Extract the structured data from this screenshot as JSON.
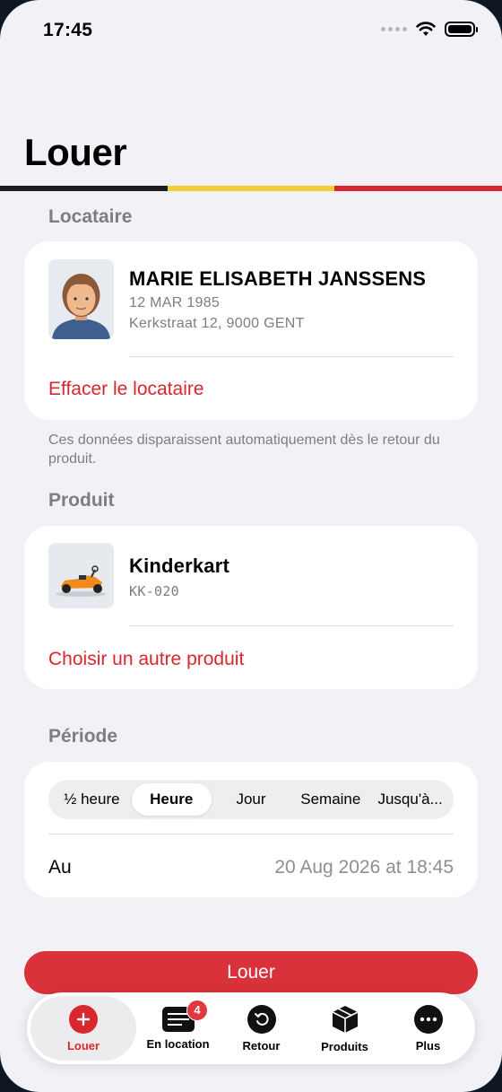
{
  "status_bar": {
    "time": "17:45"
  },
  "page": {
    "title": "Louer"
  },
  "colors": {
    "flag_black": "#1d1d1f",
    "flag_yellow": "#f0d034",
    "flag_red": "#d9272e",
    "accent": "#d9272e"
  },
  "renter": {
    "section_label": "Locataire",
    "name": "MARIE ELISABETH JANSSENS",
    "birthdate": "12 MAR 1985",
    "address": "Kerkstraat 12, 9000 GENT",
    "clear_label": "Effacer le locataire",
    "note": "Ces données disparaissent automatiquement dès le retour du produit."
  },
  "product": {
    "section_label": "Produit",
    "name": "Kinderkart",
    "code": "KK-020",
    "change_label": "Choisir un autre produit"
  },
  "period": {
    "section_label": "Période",
    "options": [
      "½ heure",
      "Heure",
      "Jour",
      "Semaine",
      "Jusqu'à..."
    ],
    "selected": "Heure",
    "until_label": "Au",
    "until_value": "20 Aug 2026 at 18:45"
  },
  "action": {
    "rent_label": "Louer"
  },
  "tabbar": {
    "items": [
      {
        "label": "Louer",
        "icon": "plus-circle-icon",
        "active": true
      },
      {
        "label": "En location",
        "icon": "list-icon",
        "badge": "4"
      },
      {
        "label": "Retour",
        "icon": "return-icon"
      },
      {
        "label": "Produits",
        "icon": "box-icon"
      },
      {
        "label": "Plus",
        "icon": "more-icon"
      }
    ]
  }
}
